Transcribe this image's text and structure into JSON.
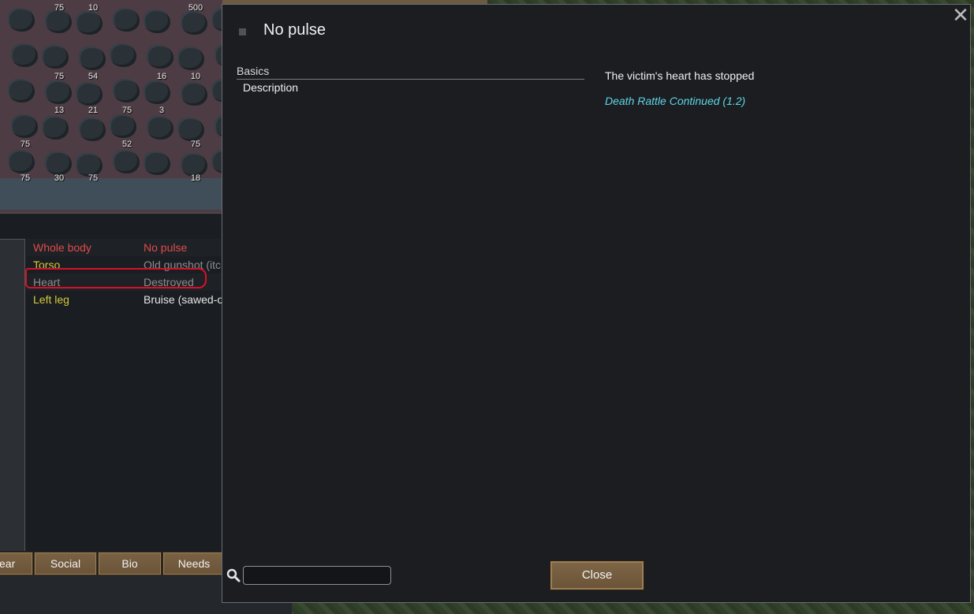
{
  "stockpile": {
    "stack_counts": [
      "75",
      "10",
      "500",
      "75",
      "54",
      "16",
      "10",
      "13",
      "21",
      "75",
      "3",
      "75",
      "52",
      "75",
      "75",
      "30",
      "75",
      "18"
    ]
  },
  "health": {
    "rows": [
      {
        "part": "Whole body",
        "condition": "No pulse",
        "part_color": "red",
        "condition_color": "red"
      },
      {
        "part": "Torso",
        "condition": "Old gunshot (itc",
        "part_color": "yellow",
        "condition_color": "grey"
      },
      {
        "part": "Heart",
        "condition": "Destroyed",
        "part_color": "grey",
        "condition_color": "grey"
      },
      {
        "part": "Left leg",
        "condition": "Bruise (sawed-o",
        "part_color": "yellow",
        "condition_color": "white"
      }
    ]
  },
  "tabs": [
    "ear",
    "Social",
    "Bio",
    "Needs"
  ],
  "dialog": {
    "title": "No pulse",
    "close_x": "✕",
    "section_header": "Basics",
    "description_label": "Description",
    "description_text": "The victim's heart has stopped",
    "mod_source": "Death Rattle Continued (1.2)",
    "search_placeholder": "",
    "search_icon": "magnifier-icon",
    "close_label": "Close"
  },
  "colors": {
    "red_text": "#e04b4b",
    "yellow_text": "#d6c93a",
    "mod_link": "#5fd7e6",
    "highlight_ring": "#d8102a",
    "button_brown": "#7e6646"
  }
}
